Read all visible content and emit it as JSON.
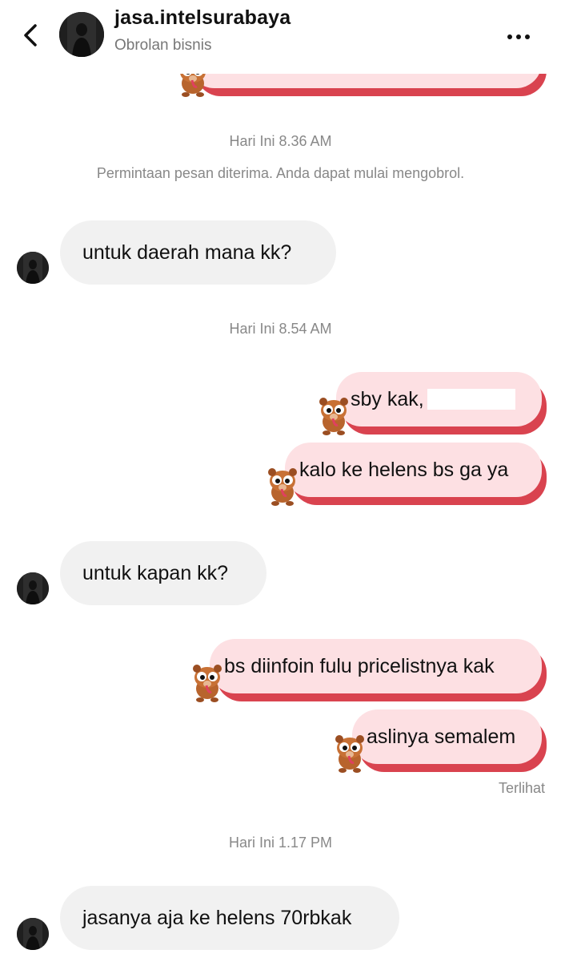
{
  "header": {
    "username": "jasa.intelsurabaya",
    "subtitle": "Obrolan bisnis",
    "back_icon": "chevron-left-icon",
    "more_icon": "more-horizontal-icon"
  },
  "system_message": "Permintaan pesan diterima. Anda dapat mulai mengobrol.",
  "timestamps": [
    "Hari Ini 8.36 AM",
    "Hari Ini 8.54 AM",
    "Hari Ini 1.17 PM"
  ],
  "incoming": [
    "untuk daerah mana kk?",
    "untuk kapan kk?",
    "jasanya aja ke helens 70rbkak"
  ],
  "outgoing": [
    "sby kak,",
    "kalo ke helens bs ga ya",
    "bs diinfoin fulu pricelistnya kak",
    "aslinya semalem"
  ],
  "status": {
    "seen": "Terlihat"
  },
  "colors": {
    "outgoing_bubble": "#fde0e3",
    "outgoing_shadow": "#d9434f",
    "incoming_bubble": "#f1f1f1"
  }
}
